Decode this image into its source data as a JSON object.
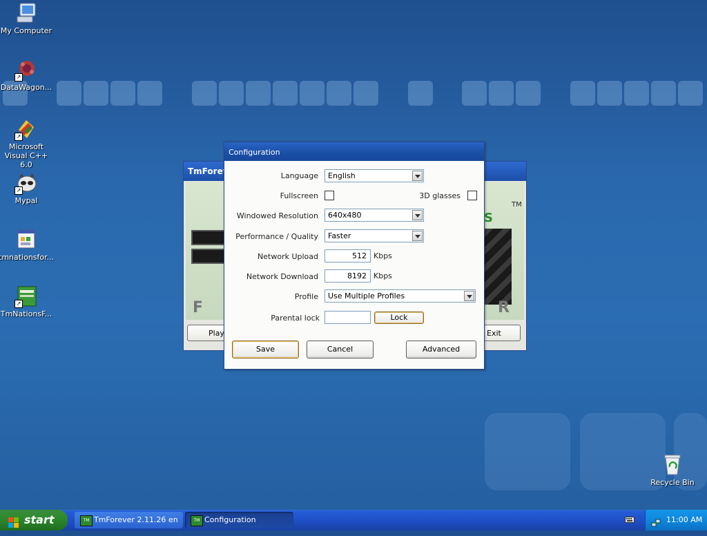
{
  "desktop": {
    "icons": [
      {
        "label": "My Computer",
        "icon": "my-computer-icon"
      },
      {
        "label": "DataWagon...",
        "icon": "datawagon-icon"
      },
      {
        "label": "Microsoft Visual C++ 6.0",
        "icon": "visual-cpp-icon"
      },
      {
        "label": "Mypal",
        "icon": "mypal-icon"
      },
      {
        "label": "tmnationsfor...",
        "icon": "installer-icon"
      },
      {
        "label": "TmNationsF...",
        "icon": "tmnations-icon"
      },
      {
        "label": "Recycle Bin",
        "icon": "recycle-bin-icon"
      }
    ]
  },
  "tm_window": {
    "title": "TmForeve",
    "play_label": "Play",
    "exit_label": "Exit",
    "art_letters": [
      "F",
      "R"
    ],
    "art_tm": "TM",
    "art_s": "S"
  },
  "config": {
    "title": "Configuration",
    "language_label": "Language",
    "language_value": "English",
    "fullscreen_label": "Fullscreen",
    "fullscreen_checked": false,
    "glasses_label": "3D glasses",
    "glasses_checked": false,
    "resolution_label": "Windowed Resolution",
    "resolution_value": "640x480",
    "quality_label": "Performance / Quality",
    "quality_value": "Faster",
    "upload_label": "Network Upload",
    "upload_value": "512",
    "upload_unit": "Kbps",
    "download_label": "Network Download",
    "download_value": "8192",
    "download_unit": "Kbps",
    "profile_label": "Profile",
    "profile_value": "Use Multiple Profiles",
    "parental_label": "Parental lock",
    "parental_value": "",
    "lock_label": "Lock",
    "save_label": "Save",
    "cancel_label": "Cancel",
    "advanced_label": "Advanced"
  },
  "taskbar": {
    "start_label": "start",
    "tasks": [
      {
        "label": "TmForever 2.11.26 en",
        "icon": "tmforever-icon"
      },
      {
        "label": "Configuration",
        "icon": "tmforever-icon"
      }
    ],
    "clock": "11:00 AM"
  },
  "colors": {
    "desktop": "#2a68ad",
    "title_bar": "#1a4ea5",
    "taskbar": "#1f50c8",
    "start": "#2e8a2e"
  }
}
